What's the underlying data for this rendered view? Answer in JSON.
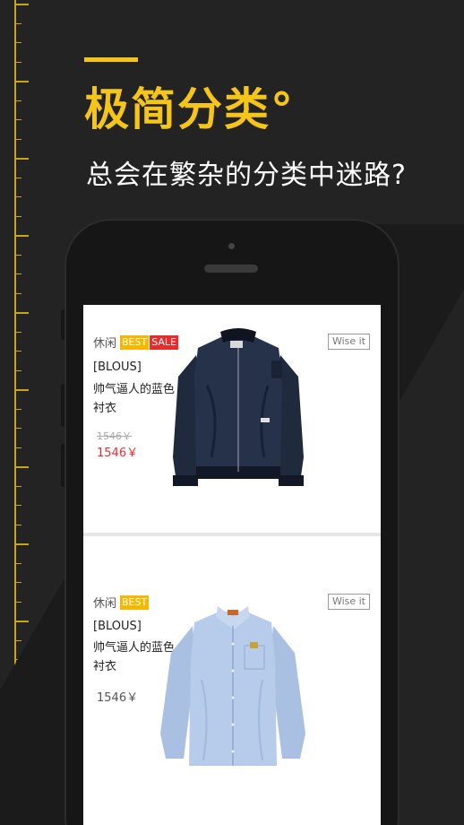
{
  "headline": {
    "title": "极简分类°",
    "subtitle": "总会在繁杂的分类中迷路?"
  },
  "colors": {
    "accent": "#f5c518",
    "background": "#232323",
    "sale_red": "#e82c2c",
    "best_yellow": "#f5b800"
  },
  "products": [
    {
      "category": "休闲",
      "badge_best": "BEST",
      "badge_sale": "SALE",
      "wise_label": "Wise it",
      "brand": "[BLOUS]",
      "name": "帅气逼人的蓝色衬衣",
      "old_price": "1546￥",
      "price": "1546￥",
      "image": "navy-bomber-jacket"
    },
    {
      "category": "休闲",
      "badge_best": "BEST",
      "wise_label": "Wise it",
      "brand": "[BLOUS]",
      "name": "帅气逼人的蓝色衬衣",
      "price": "1546￥",
      "image": "light-blue-shirt"
    }
  ]
}
